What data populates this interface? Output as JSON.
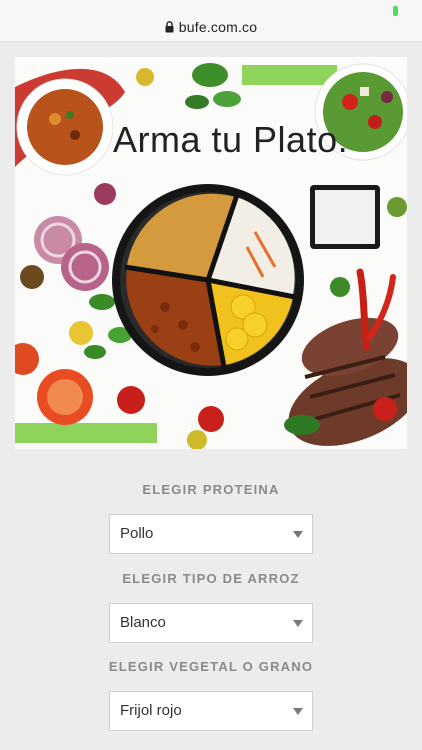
{
  "browser": {
    "url": "bufe.com.co"
  },
  "hero": {
    "title": "Arma tu Plato."
  },
  "form": {
    "protein": {
      "label": "ELEGIR PROTEINA",
      "value": "Pollo"
    },
    "rice": {
      "label": "ELEGIR TIPO DE ARROZ",
      "value": "Blanco"
    },
    "vegetable": {
      "label": "ELEGIR VEGETAL O GRANO",
      "value": "Frijol rojo"
    }
  },
  "colors": {
    "accent_green": "#8fd45a",
    "page_bg": "#ececec"
  }
}
